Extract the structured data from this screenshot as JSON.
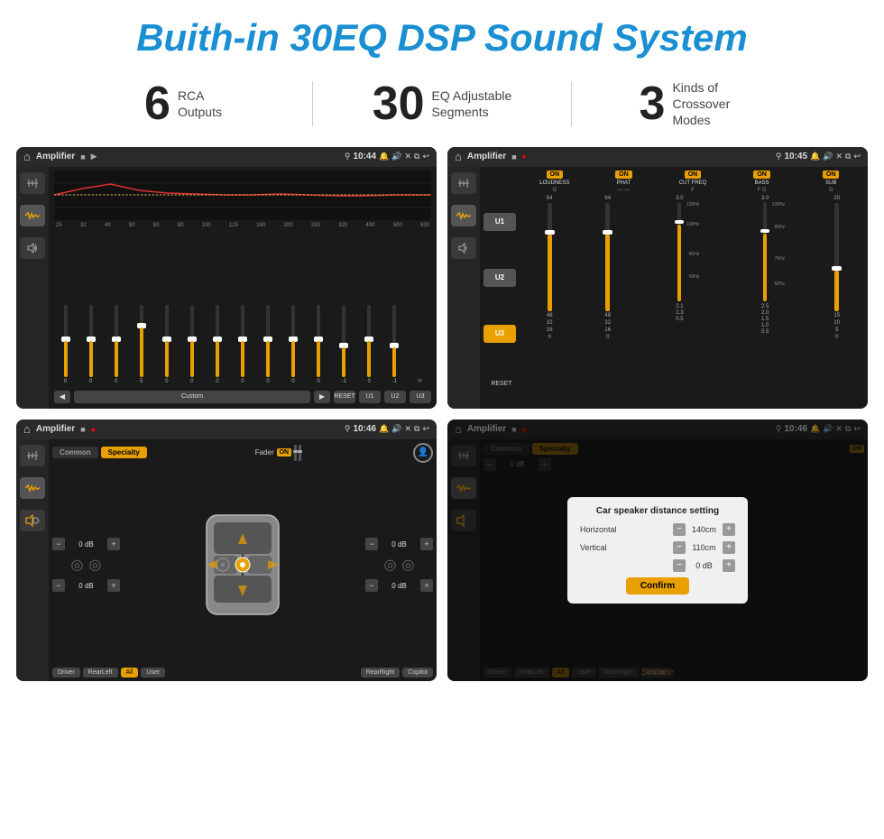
{
  "header": {
    "title": "Buith-in 30EQ DSP Sound System"
  },
  "stats": [
    {
      "number": "6",
      "label": "RCA\nOutputs"
    },
    {
      "number": "30",
      "label": "EQ Adjustable\nSegments"
    },
    {
      "number": "3",
      "label": "Kinds of\nCrossover Modes"
    }
  ],
  "screens": {
    "eq": {
      "title": "Amplifier",
      "time": "10:44",
      "freqs": [
        "25",
        "32",
        "40",
        "50",
        "63",
        "80",
        "100",
        "125",
        "160",
        "200",
        "250",
        "320",
        "400",
        "500",
        "630"
      ],
      "values": [
        "0",
        "0",
        "0",
        "5",
        "0",
        "0",
        "0",
        "0",
        "0",
        "0",
        "0",
        "-1",
        "0",
        "-1"
      ],
      "custom_label": "Custom",
      "reset_label": "RESET",
      "presets": [
        "U1",
        "U2",
        "U3"
      ]
    },
    "crossover": {
      "title": "Amplifier",
      "time": "10:45",
      "u_buttons": [
        "U1",
        "U2",
        "U3"
      ],
      "channels": [
        "LOUDNESS",
        "PHAT",
        "CUT FREQ",
        "BASS",
        "SUB"
      ],
      "on_label": "ON"
    },
    "speaker1": {
      "title": "Amplifier",
      "time": "10:46",
      "tabs": [
        "Common",
        "Specialty"
      ],
      "fader_label": "Fader",
      "on_label": "ON",
      "volumes": [
        "0 dB",
        "0 dB",
        "0 dB",
        "0 dB"
      ],
      "positions": [
        "Driver",
        "RearLeft",
        "All",
        "User",
        "RearRight",
        "Copilot"
      ]
    },
    "speaker2": {
      "title": "Amplifier",
      "time": "10:46",
      "dialog": {
        "title": "Car speaker distance setting",
        "horizontal_label": "Horizontal",
        "horizontal_value": "140cm",
        "vertical_label": "Vertical",
        "vertical_value": "110cm",
        "right_value": "0 dB",
        "confirm_label": "Confirm"
      },
      "positions": [
        "Driver",
        "RearLeft",
        "User",
        "RearRight",
        "Copilot"
      ]
    }
  },
  "icons": {
    "home": "⌂",
    "play": "▶",
    "pause": "⏸",
    "back": "↩",
    "close": "✕",
    "window": "⧉",
    "location": "⚲",
    "sound": "♪",
    "settings": "⚙",
    "equalizer": "≋",
    "wave": "〜",
    "speaker": "🔊",
    "arrows": "⇔",
    "prev": "◀",
    "next": "▶",
    "minus": "−",
    "plus": "+"
  }
}
